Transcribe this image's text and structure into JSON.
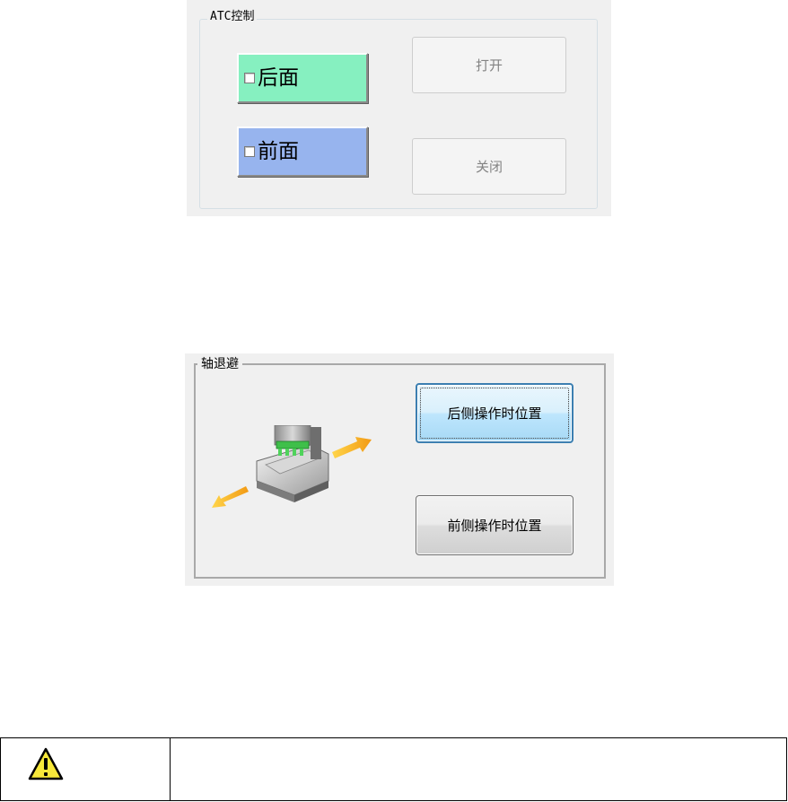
{
  "atc_panel": {
    "caption": "ATC控制",
    "rear_toggle": {
      "label": "后面",
      "checked": false,
      "color": "#86f0c0"
    },
    "front_toggle": {
      "label": "前面",
      "checked": false,
      "color": "#97b4ee"
    },
    "open_button": {
      "label": "打开",
      "enabled": false
    },
    "close_button": {
      "label": "关闭",
      "enabled": false
    }
  },
  "axis_panel": {
    "caption": "轴退避",
    "rear_position_button": {
      "label": "后侧操作时位置",
      "focused": true
    },
    "front_position_button": {
      "label": "前侧操作时位置",
      "focused": false
    },
    "illustration_icon": "machine-axis-retreat-icon"
  },
  "warning_table": {
    "icon": "warning-triangle-icon",
    "text": ""
  },
  "colors": {
    "panel_background": "#f0f0f0",
    "accent_blue": "#3c7fb1",
    "warning_yellow": "#f7e83a",
    "arrow_orange": "#f5a623"
  }
}
